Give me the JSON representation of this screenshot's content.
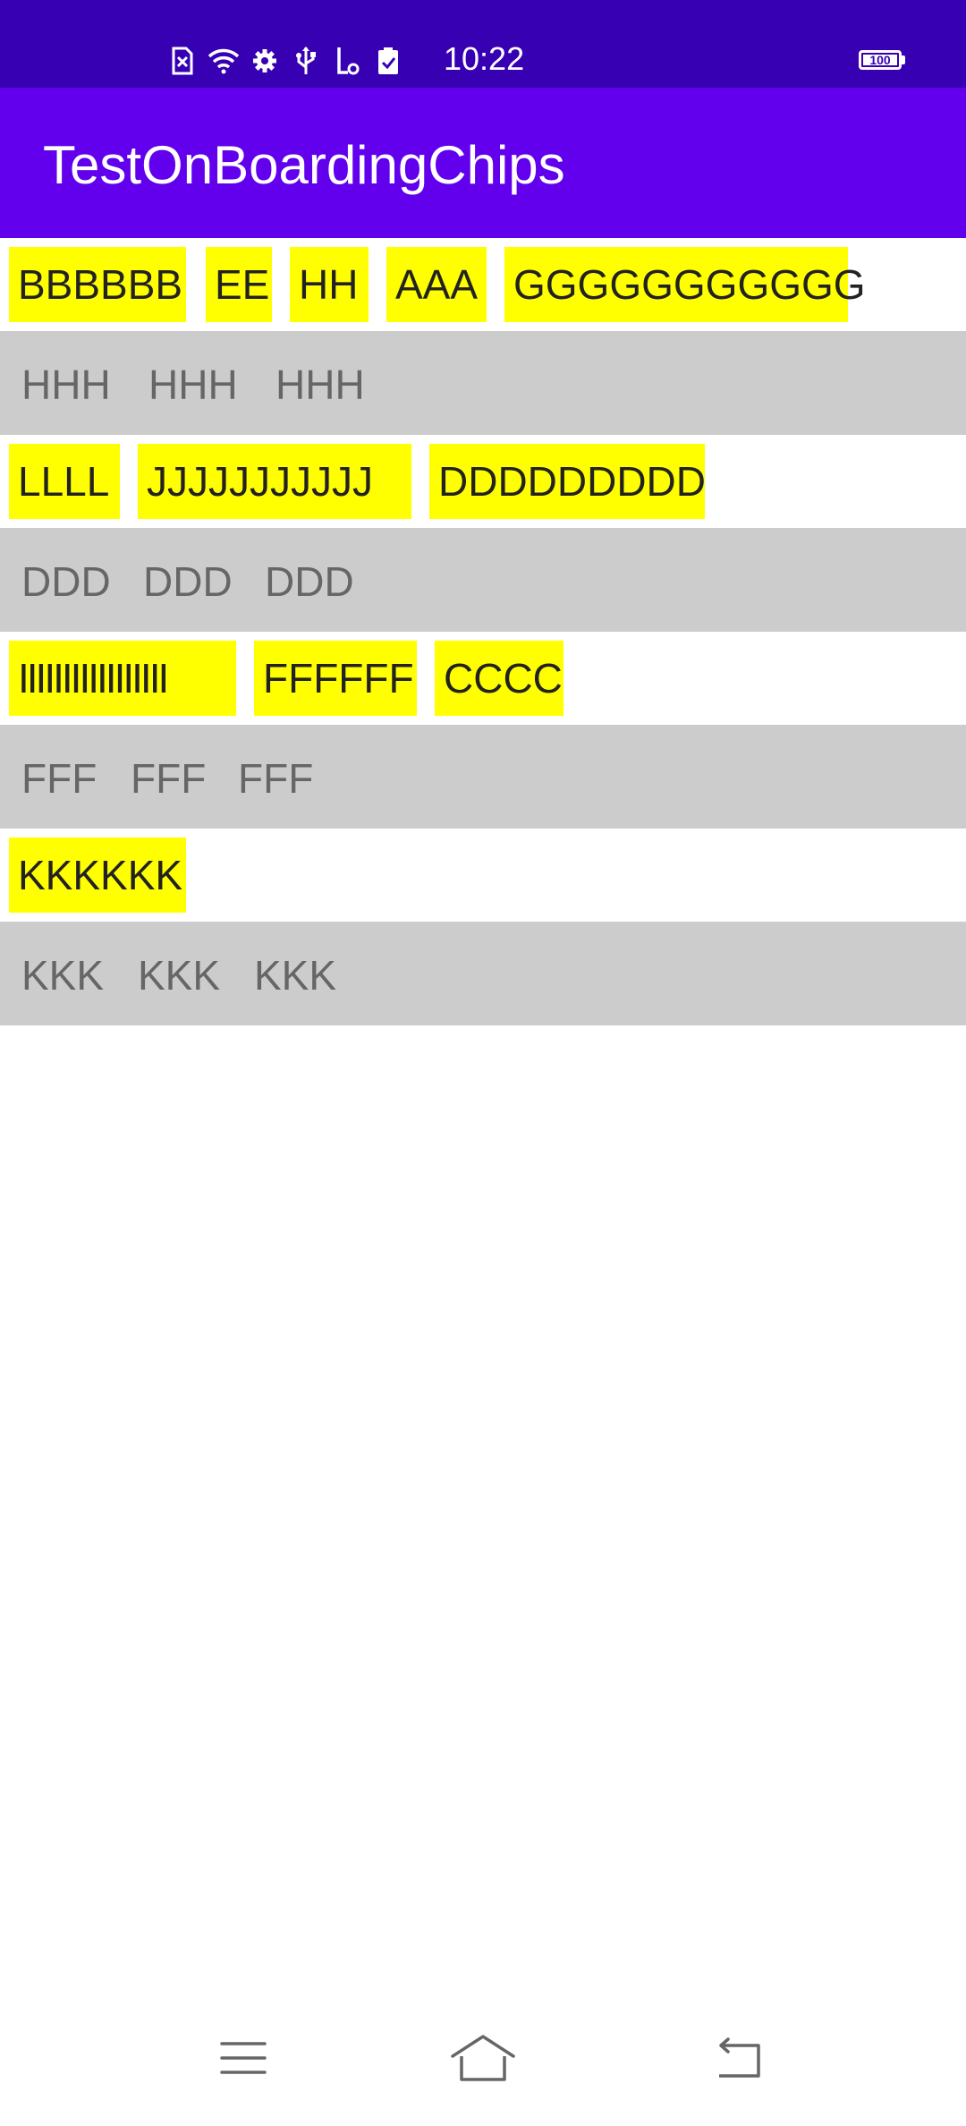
{
  "status_bar": {
    "time": "10:22",
    "battery_level": 100,
    "battery_text": "100",
    "icons": [
      "sim-off-icon",
      "wifi-icon",
      "gear-icon",
      "usb-icon",
      "debug-icon",
      "clipboard-check-icon"
    ],
    "background": "#3700b3"
  },
  "app_bar": {
    "title": "TestOnBoardingChips",
    "background": "#6200ee"
  },
  "colors": {
    "chip_background": "#ffff00",
    "plain_row_background": "#cccccc"
  },
  "groups": [
    {
      "chips": [
        "BBBBBB",
        "EE",
        "HH",
        "AAA",
        "GGGGGGGGGGG"
      ],
      "plain": [
        "HHH",
        "HHH",
        "HHH"
      ]
    },
    {
      "chips": [
        "LLLL",
        "JJJJJJJJJJJ",
        "DDDDDDDDD"
      ],
      "plain": [
        "DDD",
        "DDD",
        "DDD"
      ]
    },
    {
      "chips": [
        "IIIIIIIIIIIIIIIII",
        "FFFFFF",
        "CCCC"
      ],
      "plain": [
        "FFF",
        "FFF",
        "FFF"
      ]
    },
    {
      "chips": [
        "KKKKKK"
      ],
      "plain": [
        "KKK",
        "KKK",
        "KKK"
      ]
    }
  ],
  "nav_bar": {
    "icons": [
      "menu-icon",
      "home-icon",
      "back-icon"
    ]
  }
}
